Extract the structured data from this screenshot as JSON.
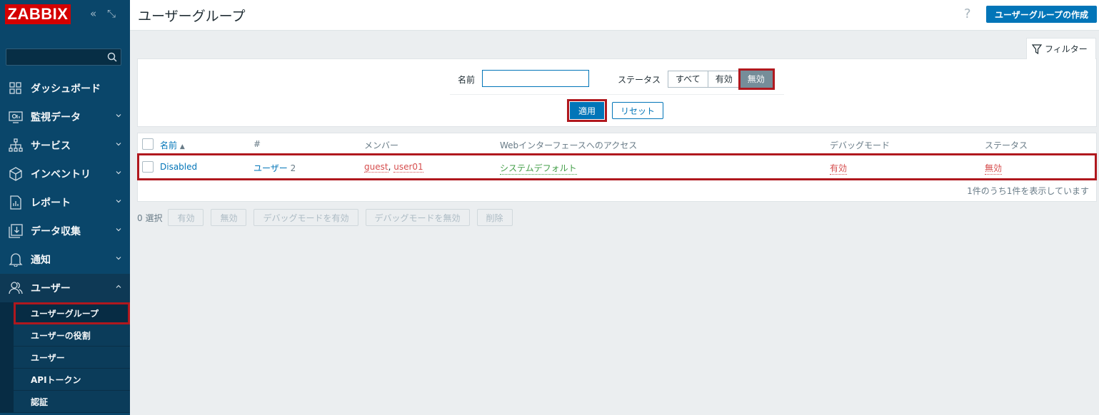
{
  "app": {
    "logo": "ZABBIX",
    "collapse_icon": "«",
    "expand_icon": "⤡"
  },
  "sidebar": {
    "search_placeholder": "",
    "items": [
      {
        "label": "ダッシュボード",
        "icon": "dashboard-icon",
        "has_chevron": false
      },
      {
        "label": "監視データ",
        "icon": "monitoring-icon",
        "has_chevron": true
      },
      {
        "label": "サービス",
        "icon": "services-icon",
        "has_chevron": true
      },
      {
        "label": "インベントリ",
        "icon": "inventory-icon",
        "has_chevron": true
      },
      {
        "label": "レポート",
        "icon": "reports-icon",
        "has_chevron": true
      },
      {
        "label": "データ収集",
        "icon": "data-collection-icon",
        "has_chevron": true
      },
      {
        "label": "通知",
        "icon": "alerts-icon",
        "has_chevron": true
      },
      {
        "label": "ユーザー",
        "icon": "users-icon",
        "has_chevron": true,
        "expanded": true
      }
    ],
    "submenu": [
      {
        "label": "ユーザーグループ",
        "selected": true
      },
      {
        "label": "ユーザーの役割"
      },
      {
        "label": "ユーザー"
      },
      {
        "label": "APIトークン"
      },
      {
        "label": "認証"
      }
    ]
  },
  "header": {
    "title": "ユーザーグループ",
    "help": "?",
    "create_button": "ユーザーグループの作成"
  },
  "filter": {
    "tab_label": "フィルター",
    "name_label": "名前",
    "name_value": "",
    "status_label": "ステータス",
    "status_options": [
      "すべて",
      "有効",
      "無効"
    ],
    "status_selected": "無効",
    "apply": "適用",
    "reset": "リセット"
  },
  "table": {
    "headers": {
      "name": "名前",
      "sort_indicator": "▲",
      "count": "#",
      "members": "メンバー",
      "web_access": "Webインターフェースへのアクセス",
      "debug": "デバッグモード",
      "status": "ステータス"
    },
    "rows": [
      {
        "name": "Disabled",
        "users_label": "ユーザー",
        "users_count": "2",
        "member1": "guest",
        "separator": ",",
        "member2": "user01",
        "web_access": "システムデフォルト",
        "debug": "有効",
        "status": "無効"
      }
    ],
    "footer": "1件のうち1件を表示しています"
  },
  "mass_actions": {
    "selected": "0 選択",
    "buttons": [
      "有効",
      "無効",
      "デバッグモードを有効",
      "デバッグモードを無効",
      "削除"
    ]
  },
  "colors": {
    "sidebar": "#0a466a",
    "primary": "#0275b8",
    "highlight": "#b0181e",
    "danger": "#d64e4e",
    "success": "#429e47"
  }
}
